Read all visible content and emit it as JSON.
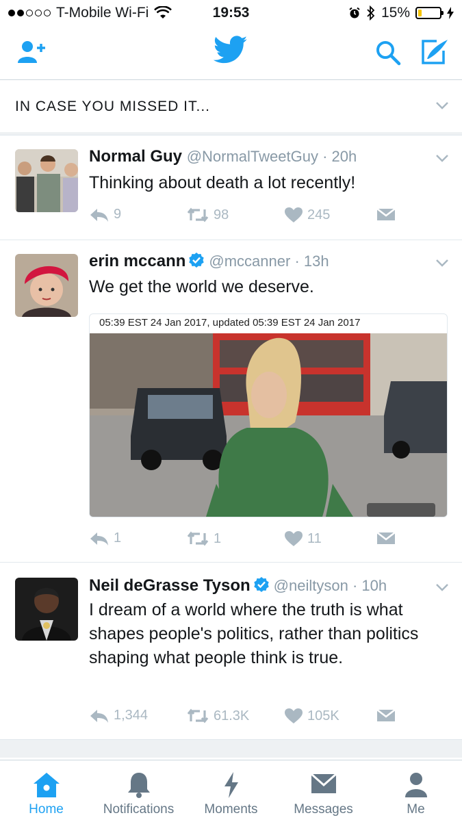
{
  "status_bar": {
    "carrier": "T-Mobile Wi-Fi",
    "time": "19:53",
    "battery": "15%",
    "battery_level": 0.15
  },
  "section_header": {
    "title": "IN CASE YOU MISSED IT..."
  },
  "tweets": [
    {
      "name": "Normal Guy",
      "handle": "@NormalTweetGuy",
      "time": "20h",
      "text": "Thinking about death a lot recently!",
      "replies": "9",
      "retweets": "98",
      "likes": "245",
      "verified": false
    },
    {
      "name": "erin mccann",
      "handle": "@mccanner",
      "time": "13h",
      "text": "We get the world we deserve.",
      "media_caption": "05:39 EST 24 Jan 2017, updated 05:39 EST 24 Jan 2017",
      "replies": "1",
      "retweets": "1",
      "likes": "11",
      "verified": true
    },
    {
      "name": "Neil deGrasse Tyson",
      "handle": "@neiltyson",
      "time": "10h",
      "text": "I dream of a world where the truth is what shapes people's politics, rather than politics shaping what people think is true.",
      "replies": "1,344",
      "retweets": "61.3K",
      "likes": "105K",
      "verified": true
    }
  ],
  "tabs": [
    {
      "label": "Home",
      "icon": "home-icon",
      "active": true
    },
    {
      "label": "Notifications",
      "icon": "bell-icon",
      "active": false
    },
    {
      "label": "Moments",
      "icon": "lightning-icon",
      "active": false
    },
    {
      "label": "Messages",
      "icon": "envelope-icon",
      "active": false
    },
    {
      "label": "Me",
      "icon": "person-icon",
      "active": false
    }
  ],
  "colors": {
    "accent": "#1da1f2",
    "muted": "#aab8c2",
    "text": "#14171a",
    "verified": "#1da1f2"
  }
}
